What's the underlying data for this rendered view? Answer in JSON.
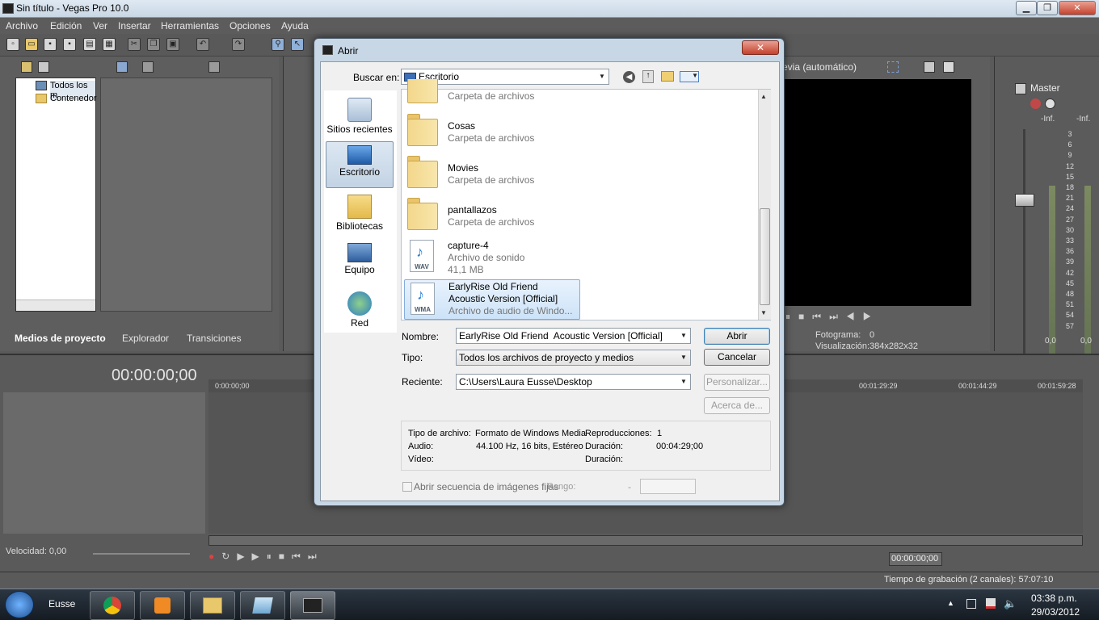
{
  "window": {
    "title": "Sin título - Vegas Pro 10.0",
    "minimize": "▁",
    "maximize": "❐",
    "close": "✕"
  },
  "menu": [
    "Archivo",
    "Edición",
    "Ver",
    "Insertar",
    "Herramientas",
    "Opciones",
    "Ayuda"
  ],
  "left_panel": {
    "tree": [
      "Todos los m",
      "Contenedor"
    ],
    "tabs": [
      "Medios de proyecto",
      "Explorador",
      "Transiciones"
    ]
  },
  "preview": {
    "mode": "evia (automático)",
    "frame_label": "Fotograma:",
    "frame_value": "0",
    "display_label": "Visualización:",
    "display_value": "384x282x32"
  },
  "mixer": {
    "title": "Master",
    "inf_left": "-Inf.",
    "inf_right": "-Inf.",
    "scale": [
      "3",
      "6",
      "9",
      "12",
      "15",
      "18",
      "21",
      "24",
      "27",
      "30",
      "33",
      "36",
      "39",
      "42",
      "45",
      "48",
      "51",
      "54",
      "57"
    ],
    "val_left": "0,0",
    "val_right": "0,0"
  },
  "timeline": {
    "timecode": "00:00:00;00",
    "ruler": [
      "0:00:00;00",
      "00:01:29:29",
      "00:01:44:29",
      "00:01:59:28"
    ],
    "speed": "Velocidad: 0,00",
    "cursor_tc": "00:00:00;00"
  },
  "status": {
    "record_time": "Tiempo de grabación (2 canales): 57:07:10"
  },
  "taskbar": {
    "user": "Eusse",
    "time": "03:38 p.m.",
    "date": "29/03/2012"
  },
  "dialog": {
    "title": "Abrir",
    "look_in_label": "Buscar en:",
    "look_in_value": "Escritorio",
    "places": [
      "Sitios recientes",
      "Escritorio",
      "Bibliotecas",
      "Equipo",
      "Red"
    ],
    "files": [
      {
        "name": "",
        "desc": "Carpeta de archivos",
        "kind": "folder"
      },
      {
        "name": "Cosas",
        "desc": "Carpeta de archivos",
        "kind": "folder"
      },
      {
        "name": "Movies",
        "desc": "Carpeta de archivos",
        "kind": "folder"
      },
      {
        "name": "pantallazos",
        "desc": "Carpeta de archivos",
        "kind": "folder"
      },
      {
        "name": "capture-4",
        "desc": "Archivo de sonido",
        "size": "41,1 MB",
        "kind": "wav",
        "ext": "WAV"
      },
      {
        "name": "EarlyRise Old Friend",
        "name2": "Acoustic Version [Official]",
        "desc": "Archivo de audio de Windo...",
        "kind": "wma",
        "ext": "WMA"
      }
    ],
    "name_label": "Nombre:",
    "name_value": "EarlyRise Old Friend  Acoustic Version [Official]",
    "type_label": "Tipo:",
    "type_value": "Todos los archivos de proyecto y medios",
    "recent_label": "Reciente:",
    "recent_value": "C:\\Users\\Laura Eusse\\Desktop",
    "open_btn": "Abrir",
    "cancel_btn": "Cancelar",
    "customize_btn": "Personalizar...",
    "about_btn": "Acerca de...",
    "info": {
      "filetype_label": "Tipo de archivo:",
      "filetype_value": "Formato de Windows Media",
      "plays_label": "Reproducciones:",
      "plays_value": "1",
      "audio_label": "Audio:",
      "audio_value": "44.100 Hz, 16 bits, Estéreo",
      "duration_label": "Duración:",
      "duration_value": "00:04:29;00",
      "video_label": "Vídeo:",
      "video_duration_label": "Duración:"
    },
    "sequence_label": "Abrir secuencia de imágenes fijas",
    "range_label": "Rango:",
    "range_sep": "-"
  }
}
